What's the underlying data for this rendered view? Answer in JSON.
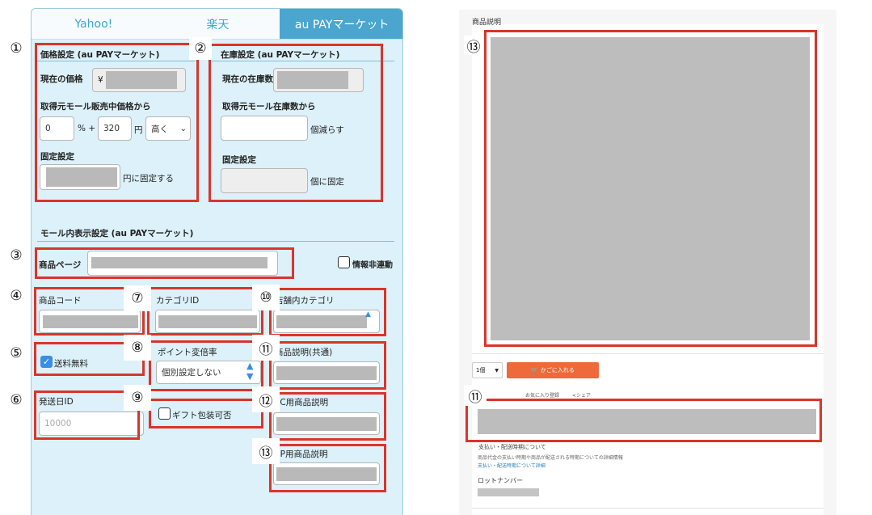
{
  "tabs": [
    {
      "label": "Yahoo!",
      "active": false
    },
    {
      "label": "楽天",
      "active": false
    },
    {
      "label": "au PAYマーケット",
      "active": true
    }
  ],
  "price": {
    "title": "価格設定 (au PAYマーケット)",
    "current_label": "現在の価格",
    "currency": "¥",
    "from_mall_label": "取得元モール販売中価格から",
    "percent_value": "0",
    "percent_suffix": "% +",
    "yen_value": "320",
    "yen_suffix": "円",
    "direction": "高く",
    "fixed_label": "固定設定",
    "fixed_suffix": "円に固定する"
  },
  "stock": {
    "title": "在庫設定 (au PAYマーケット)",
    "current_label": "現在の在庫数",
    "from_mall_label": "取得元モール在庫数から",
    "decrease_suffix": "個減らす",
    "fixed_label": "固定設定",
    "fixed_suffix": "個に固定"
  },
  "display": {
    "title": "モール内表示設定 (au PAYマーケット)",
    "product_page_label": "商品ページ",
    "info_unlink_label": "情報非連動",
    "product_code_label": "商品コード",
    "category_id_label": "カテゴリID",
    "shop_category_label": "店舗内カテゴリ",
    "free_shipping_label": "送料無料",
    "free_shipping_checked": true,
    "point_rate_label": "ポイント変倍率",
    "point_rate_value": "個別設定しない",
    "description_common_label": "商品説明(共通)",
    "ship_day_label": "発送日ID",
    "ship_day_placeholder": "10000",
    "gift_wrap_label": "ギフト包装可否",
    "pc_description_label": "PC用商品説明",
    "sp_description_label": "SP用商品説明"
  },
  "badges": [
    "①",
    "②",
    "③",
    "④",
    "⑤",
    "⑥",
    "⑦",
    "⑧",
    "⑨",
    "⑩",
    "⑪",
    "⑫",
    "⑬"
  ],
  "preview": {
    "section_title": "商品説明",
    "badge_top": "⑬",
    "badge_mid": "⑪",
    "qty_value": "1個",
    "cart_button": "かごに入れる",
    "favorites_text": "お気に入り登録",
    "share_text": "シェア",
    "payment_heading": "支払い・配送時期について",
    "payment_desc": "商品代金の支払い時期や商品が配送される時期についての詳細情報",
    "payment_link": "支払い・配送時期について詳細",
    "lot_label": "ロットナンバー"
  },
  "colors": {
    "accent_red": "#d9352b",
    "tab_active": "#4aa6cf",
    "panel_bg": "#dcf1f9",
    "cart_orange": "#ee6a3a"
  }
}
